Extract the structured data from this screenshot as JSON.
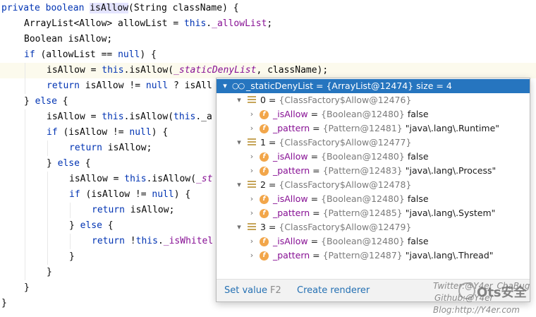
{
  "editor": {
    "lines": [
      [
        {
          "t": "private boolean ",
          "c": "kw"
        },
        {
          "t": "isAllow",
          "c": "hl"
        },
        {
          "t": "(String className) {"
        }
      ],
      [
        {
          "t": "ArrayList<Allow> allowList = "
        },
        {
          "t": "this",
          "c": "kw"
        },
        {
          "t": "."
        },
        {
          "t": "_allowList",
          "c": "fld"
        },
        {
          "t": ";"
        }
      ],
      [
        {
          "t": "Boolean isAllow;"
        }
      ],
      [
        {
          "t": "if",
          "c": "kw"
        },
        {
          "t": " (allowList == "
        },
        {
          "t": "null",
          "c": "kw"
        },
        {
          "t": ") {"
        }
      ],
      [
        {
          "t": "isAllow = "
        },
        {
          "t": "this",
          "c": "kw"
        },
        {
          "t": ".isAllow("
        },
        {
          "t": "_staticDenyList",
          "c": "sfld"
        },
        {
          "t": ", className);"
        }
      ],
      [
        {
          "t": "return",
          "c": "kw"
        },
        {
          "t": " isAllow != "
        },
        {
          "t": "null",
          "c": "kw"
        },
        {
          "t": " ? isAll"
        }
      ],
      [
        {
          "t": "} "
        },
        {
          "t": "else",
          "c": "kw"
        },
        {
          "t": " {"
        }
      ],
      [
        {
          "t": "isAllow = "
        },
        {
          "t": "this",
          "c": "kw"
        },
        {
          "t": ".isAllow("
        },
        {
          "t": "this",
          "c": "kw"
        },
        {
          "t": "._a"
        }
      ],
      [
        {
          "t": "if",
          "c": "kw"
        },
        {
          "t": " (isAllow != "
        },
        {
          "t": "null",
          "c": "kw"
        },
        {
          "t": ") {"
        }
      ],
      [
        {
          "t": "return",
          "c": "kw"
        },
        {
          "t": " isAllow;"
        }
      ],
      [
        {
          "t": "} "
        },
        {
          "t": "else",
          "c": "kw"
        },
        {
          "t": " {"
        }
      ],
      [
        {
          "t": "isAllow = "
        },
        {
          "t": "this",
          "c": "kw"
        },
        {
          "t": ".isAllow("
        },
        {
          "t": "_st",
          "c": "sfld"
        }
      ],
      [
        {
          "t": "if",
          "c": "kw"
        },
        {
          "t": " (isAllow != "
        },
        {
          "t": "null",
          "c": "kw"
        },
        {
          "t": ") {"
        }
      ],
      [
        {
          "t": "return",
          "c": "kw"
        },
        {
          "t": " isAllow;"
        }
      ],
      [
        {
          "t": "} "
        },
        {
          "t": "else",
          "c": "kw"
        },
        {
          "t": " {"
        }
      ],
      [
        {
          "t": "return",
          "c": "kw"
        },
        {
          "t": " !"
        },
        {
          "t": "this",
          "c": "kw"
        },
        {
          "t": "."
        },
        {
          "t": "_isWhitel",
          "c": "fld"
        }
      ],
      [
        {
          "t": "}"
        }
      ],
      [
        {
          "t": "}"
        }
      ],
      [
        {
          "t": "}"
        }
      ],
      [
        {
          "t": "}"
        }
      ]
    ]
  },
  "debug_popup": {
    "root": {
      "name": "_staticDenyList",
      "eq": " = ",
      "value": "{ArrayList@12474}",
      "extra": "  size = 4"
    },
    "elements": [
      {
        "index": "0",
        "type": "{ClassFactory$Allow@12476}",
        "fields": [
          {
            "name": "_isAllow",
            "type": "{Boolean@12480}",
            "value": "false"
          },
          {
            "name": "_pattern",
            "type": "{Pattern@12481}",
            "value": "\"java\\.lang\\.Runtime\""
          }
        ]
      },
      {
        "index": "1",
        "type": "{ClassFactory$Allow@12477}",
        "fields": [
          {
            "name": "_isAllow",
            "type": "{Boolean@12480}",
            "value": "false"
          },
          {
            "name": "_pattern",
            "type": "{Pattern@12483}",
            "value": "\"java\\.lang\\.Process\""
          }
        ]
      },
      {
        "index": "2",
        "type": "{ClassFactory$Allow@12478}",
        "fields": [
          {
            "name": "_isAllow",
            "type": "{Boolean@12480}",
            "value": "false"
          },
          {
            "name": "_pattern",
            "type": "{Pattern@12485}",
            "value": "\"java\\.lang\\.System\""
          }
        ]
      },
      {
        "index": "3",
        "type": "{ClassFactory$Allow@12479}",
        "fields": [
          {
            "name": "_isAllow",
            "type": "{Boolean@12480}",
            "value": "false"
          },
          {
            "name": "_pattern",
            "type": "{Pattern@12487}",
            "value": "\"java\\.lang\\.Thread\""
          }
        ]
      }
    ],
    "footer": {
      "set_value_label": "Set value",
      "set_value_shortcut": "F2",
      "create_renderer_label": "Create renderer"
    }
  },
  "watermark": {
    "twitter": "Twitter:@Y4er_ChaBug",
    "github": "Github:@Y4er",
    "blog": "Blog:http://Y4er.com",
    "brand": "Ots安全"
  },
  "colors": {
    "keyword": "#0033b3",
    "field": "#871094",
    "selection": "#2675bf",
    "link": "#2470b3",
    "current_line": "#fcfaed"
  }
}
